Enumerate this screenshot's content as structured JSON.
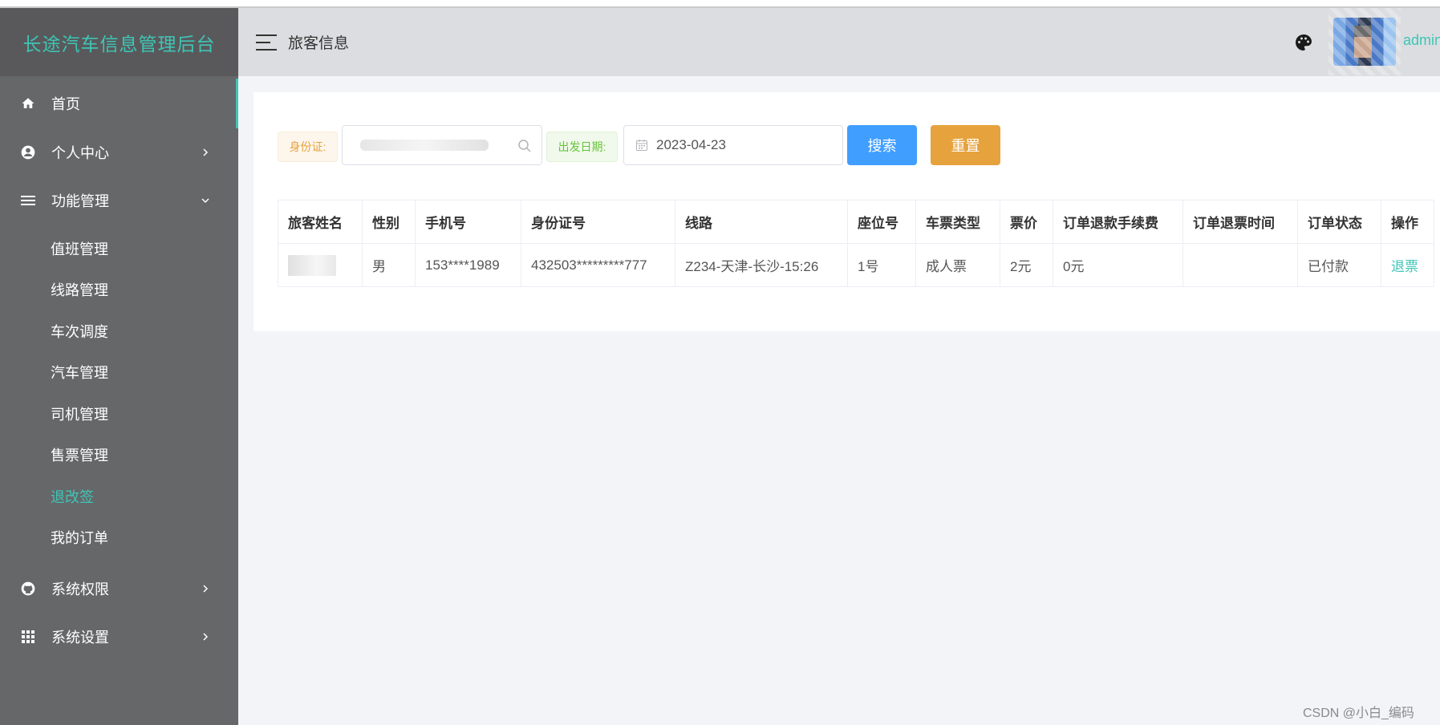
{
  "app": {
    "title": "长途汽车信息管理后台"
  },
  "sidebar": {
    "items": [
      {
        "label": "首页",
        "icon": "home-icon"
      },
      {
        "label": "个人中心",
        "icon": "user-circle-icon"
      },
      {
        "label": "功能管理",
        "icon": "list-icon"
      }
    ],
    "submenu": [
      {
        "label": "值班管理"
      },
      {
        "label": "线路管理"
      },
      {
        "label": "车次调度"
      },
      {
        "label": "汽车管理"
      },
      {
        "label": "司机管理"
      },
      {
        "label": "售票管理"
      },
      {
        "label": "退改签"
      },
      {
        "label": "我的订单"
      }
    ],
    "bottom_items": [
      {
        "label": "系统权限",
        "icon": "github-icon"
      },
      {
        "label": "系统设置",
        "icon": "grid-icon"
      }
    ],
    "active": "退改签",
    "accent_color": "#3ec5b6"
  },
  "header": {
    "title": "旅客信息",
    "username": "admin"
  },
  "search": {
    "id_label": "身份证:",
    "date_label": "出发日期:",
    "date_value": "2023-04-23",
    "search_button": "搜索",
    "reset_button": "重置"
  },
  "table": {
    "columns": [
      "旅客姓名",
      "性别",
      "手机号",
      "身份证号",
      "线路",
      "座位号",
      "车票类型",
      "票价",
      "订单退款手续费",
      "订单退票时间",
      "订单状态",
      "操作"
    ],
    "rows": [
      {
        "gender": "男",
        "phone": "153****1989",
        "id_number": "432503*********777",
        "route": "Z234-天津-长沙-15:26",
        "seat": "1号",
        "ticket_type": "成人票",
        "price": "2元",
        "refund_fee": "0元",
        "refund_time": "",
        "status": "已付款",
        "action": "退票"
      }
    ]
  },
  "watermark": "CSDN @小白_编码"
}
